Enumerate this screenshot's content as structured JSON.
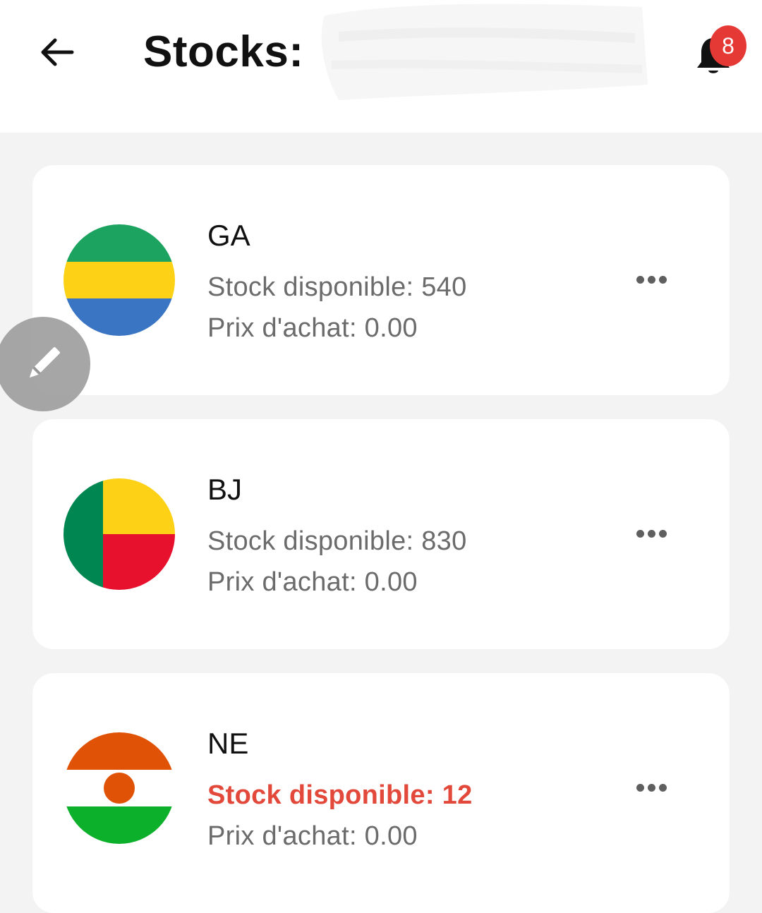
{
  "header": {
    "title": "Stocks:",
    "notification_count": "8",
    "icons": {
      "back": "arrow-left-icon",
      "bell": "bell-icon"
    }
  },
  "stocks": [
    {
      "code": "GA",
      "stock_label": "Stock disponible: 540",
      "price_label": "Prix d'achat: 0.00",
      "low_stock": false,
      "flag_colors": [
        "#1ca35f",
        "#fcd116",
        "#3a75c4"
      ]
    },
    {
      "code": "BJ",
      "stock_label": "Stock disponible: 830",
      "price_label": "Prix d'achat: 0.00",
      "low_stock": false,
      "flag_colors": [
        "#008751",
        "#fcd116",
        "#e8112d"
      ]
    },
    {
      "code": "NE",
      "stock_label": "Stock disponible: 12",
      "price_label": "Prix d'achat: 0.00",
      "low_stock": true,
      "flag_colors": [
        "#e05206",
        "#ffffff",
        "#0db02b"
      ]
    }
  ],
  "colors": {
    "background": "#f3f3f3",
    "card": "#ffffff",
    "badge": "#e53935",
    "low_stock_text": "#e2493b",
    "secondary_text": "#6b6b6b"
  },
  "fab": {
    "icon": "pencil-icon"
  }
}
